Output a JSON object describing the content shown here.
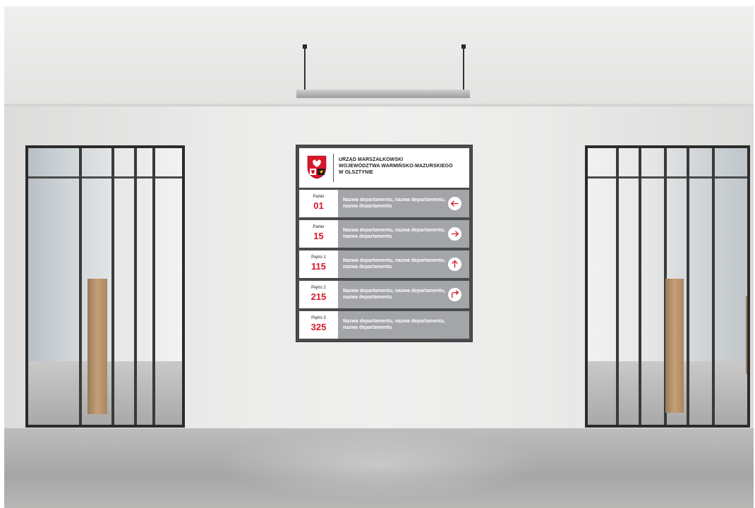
{
  "sign": {
    "header_lines": [
      "URZĄD MARSZAŁKOWSKI",
      "WOJEWÓDZTWA WARMIŃSKO-MAZURSKIEGO",
      "W OLSZTYNIE"
    ],
    "rows": [
      {
        "floor": "Parter",
        "room": "01",
        "desc": "Nazwa departamentu, nazwa departamentu, nazwa departamentu",
        "arrow": "arrow-left-icon"
      },
      {
        "floor": "Parter",
        "room": "15",
        "desc": "Nazwa departamentu, nazwa departamentu, nazwa departamentu",
        "arrow": "arrow-right-icon"
      },
      {
        "floor": "Piętro 1",
        "room": "115",
        "desc": "Nazwa departamentu, nazwa departamentu, nazwa departamentu",
        "arrow": "arrow-up-icon"
      },
      {
        "floor": "Piętro 2",
        "room": "215",
        "desc": "Nazwa departamentu, nazwa departamentu, nazwa departamentu",
        "arrow": "arrow-turn-right-icon"
      },
      {
        "floor": "Piętro 3",
        "room": "325",
        "desc": "Nazwa departamentu, nazwa departamentu, nazwa departamentu",
        "arrow": ""
      }
    ],
    "colors": {
      "accent": "#d9162a",
      "row_panel": "#a3a5a8",
      "frame": "#4a4b4d"
    }
  }
}
